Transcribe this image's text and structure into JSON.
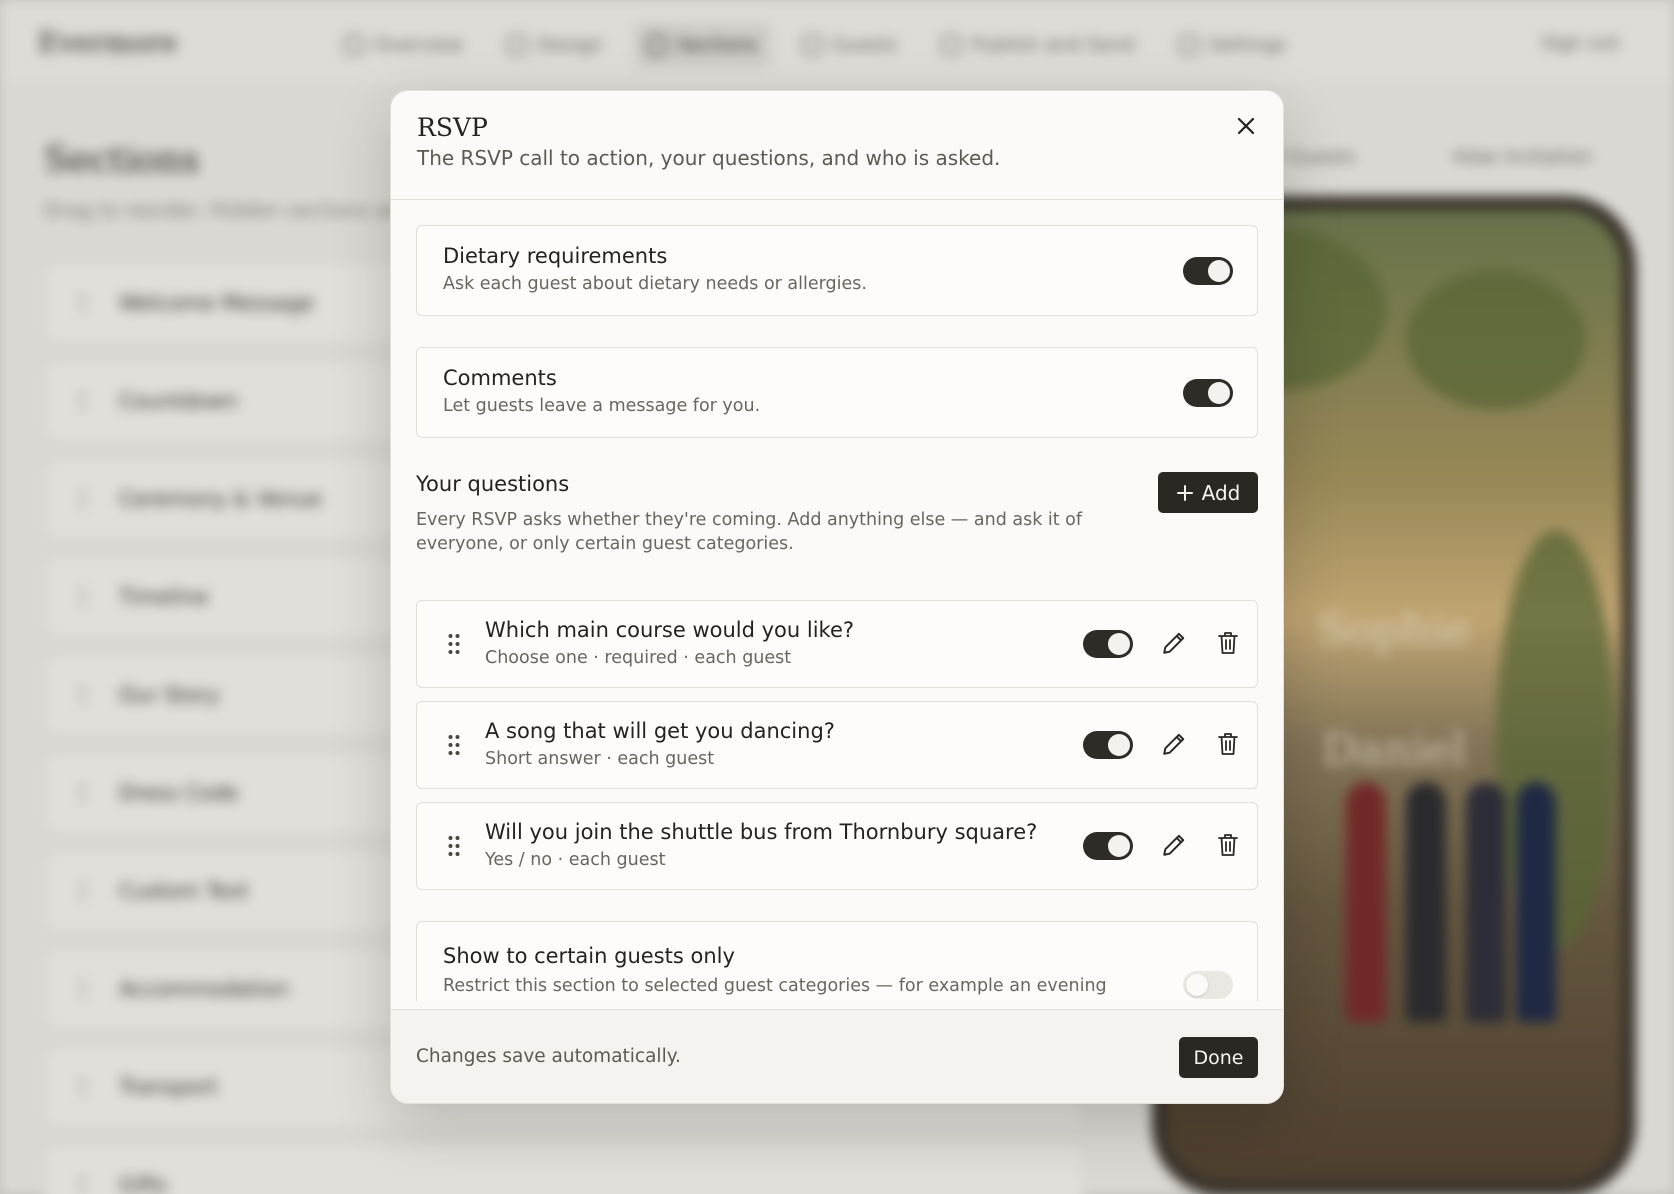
{
  "background": {
    "brand": "Evermore",
    "nav": [
      {
        "label": "Overview",
        "icon": "home-icon",
        "active": false
      },
      {
        "label": "Design",
        "icon": "palette-icon",
        "active": false
      },
      {
        "label": "Sections",
        "icon": "grid-icon",
        "active": true
      },
      {
        "label": "Guests",
        "icon": "users-icon",
        "active": false
      },
      {
        "label": "Publish and Send",
        "icon": "share-icon",
        "active": false
      },
      {
        "label": "Settings",
        "icon": "gear-icon",
        "active": false
      }
    ],
    "sign_out": "Sign out",
    "page_title": "Sections",
    "page_subtitle": "Drag to reorder. Hidden sections are...",
    "guest_filter": "All Guests",
    "view_invitation": "View invitation",
    "sections": [
      "Welcome Message",
      "Countdown",
      "Ceremony & Venue",
      "Timeline",
      "Our Story",
      "Dress Code",
      "Custom Text",
      "Accommodation",
      "Transport",
      "Gifts"
    ],
    "preview_names": [
      "Sophie",
      "Daniel"
    ]
  },
  "modal": {
    "title": "RSVP",
    "subtitle": "The RSVP call to action, your questions, and who is asked.",
    "close_icon": "close-icon",
    "options": [
      {
        "title": "Dietary requirements",
        "description": "Ask each guest about dietary needs or allergies.",
        "enabled": true
      },
      {
        "title": "Comments",
        "description": "Let guests leave a message for you.",
        "enabled": true
      }
    ],
    "questions_section": {
      "title": "Your questions",
      "description": "Every RSVP asks whether they're coming. Add anything else — and ask it of everyone, or only certain guest categories.",
      "add_label": "Add"
    },
    "questions": [
      {
        "label": "Which main course would you like?",
        "meta": "Choose one · required · each guest",
        "enabled": true
      },
      {
        "label": "A song that will get you dancing?",
        "meta": "Short answer · each guest",
        "enabled": true
      },
      {
        "label": "Will you join the shuttle bus from Thornbury square?",
        "meta": "Yes / no · each guest",
        "enabled": true
      }
    ],
    "restrict": {
      "title": "Show to certain guests only",
      "description": "Restrict this section to selected guest categories — for example an evening reception shown only to Evening Guests.",
      "enabled": false
    },
    "footer_note": "Changes save automatically.",
    "done_label": "Done"
  },
  "colors": {
    "accent_dark": "#2b2824",
    "background": "#efede8",
    "modal_bg": "#fbfaf8"
  }
}
